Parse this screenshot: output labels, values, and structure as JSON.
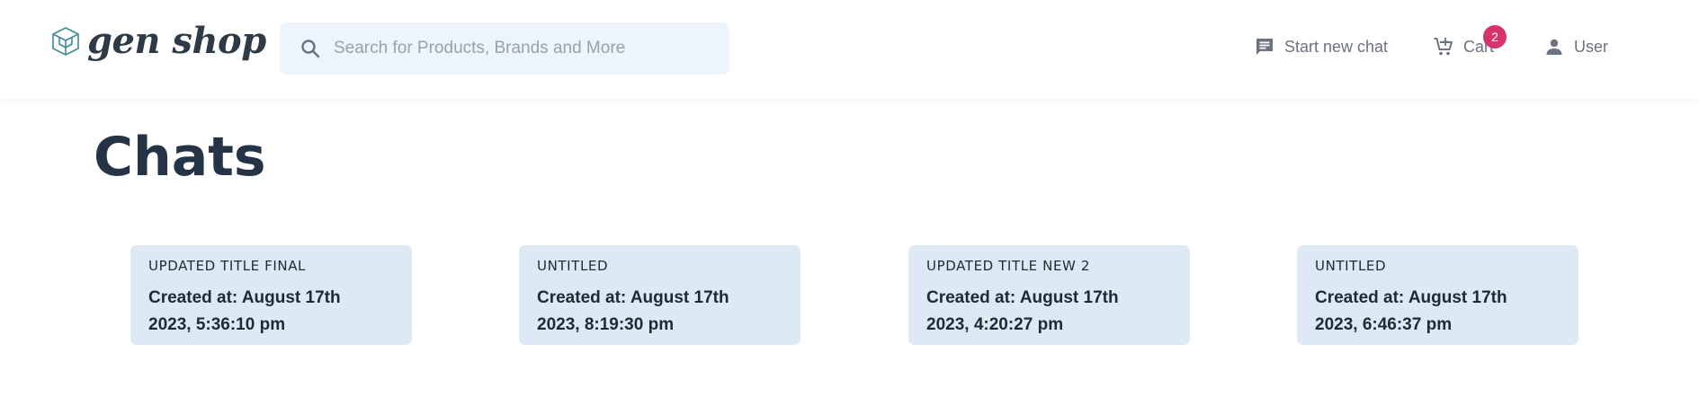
{
  "header": {
    "logo_text": "gen shop",
    "search": {
      "placeholder": "Search for Products, Brands and More",
      "value": ""
    },
    "nav": {
      "start_chat": "Start new chat",
      "cart": "Cart",
      "cart_count": "2",
      "user": "User"
    }
  },
  "page": {
    "title": "Chats"
  },
  "chats": [
    {
      "title": "UPDATED TITLE FINAL",
      "created_line1": "Created at: August 17th",
      "created_line2": "2023, 5:36:10 pm"
    },
    {
      "title": "UNTITLED",
      "created_line1": "Created at: August 17th",
      "created_line2": "2023, 8:19:30 pm"
    },
    {
      "title": "UPDATED TITLE NEW 2",
      "created_line1": "Created at: August 17th",
      "created_line2": "2023, 4:20:27 pm"
    },
    {
      "title": "UNTITLED",
      "created_line1": "Created at: August 17th",
      "created_line2": "2023, 6:46:37 pm"
    }
  ],
  "colors": {
    "card_bg": "#dde9f4",
    "badge": "#d6336c",
    "search_bg": "#eef4fd",
    "title": "#253347"
  },
  "icons": [
    "logo-icon",
    "search-icon",
    "chat-icon",
    "cart-icon",
    "user-icon"
  ]
}
